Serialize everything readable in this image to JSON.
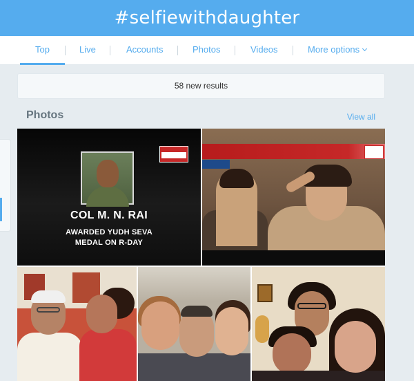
{
  "header": {
    "title": "#selfiewithdaughter"
  },
  "tabs": [
    {
      "label": "Top",
      "active": true
    },
    {
      "label": "Live"
    },
    {
      "label": "Accounts"
    },
    {
      "label": "Photos"
    },
    {
      "label": "Videos"
    },
    {
      "label": "More options"
    }
  ],
  "results_banner": {
    "text": "58 new results"
  },
  "photos_section": {
    "title": "Photos",
    "view_all": "View all",
    "photo1": {
      "name": "COL M. N. RAI",
      "line1": "AWARDED YUDH SEVA",
      "line2": "MEDAL ON R-DAY"
    }
  },
  "colors": {
    "header_bg": "#55acee",
    "link": "#55acee",
    "page_bg": "#e6ecf0"
  }
}
